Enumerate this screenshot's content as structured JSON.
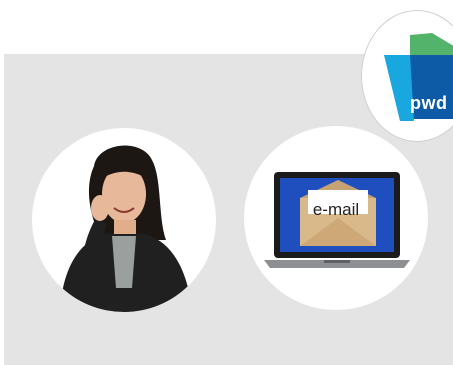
{
  "logo": {
    "text": "pwd"
  },
  "email_card": {
    "label": "e-mail"
  },
  "icons": {
    "phone": "person-on-phone-icon",
    "email": "laptop-email-icon",
    "logo": "pwd-logo-icon"
  },
  "colors": {
    "panel": "#e4e4e4",
    "logo_blue": "#0d5aa7",
    "logo_cyan": "#1ab0e8",
    "logo_green": "#53b36b",
    "laptop_screen": "#1f4fbf",
    "envelope": "#d9b98a"
  }
}
